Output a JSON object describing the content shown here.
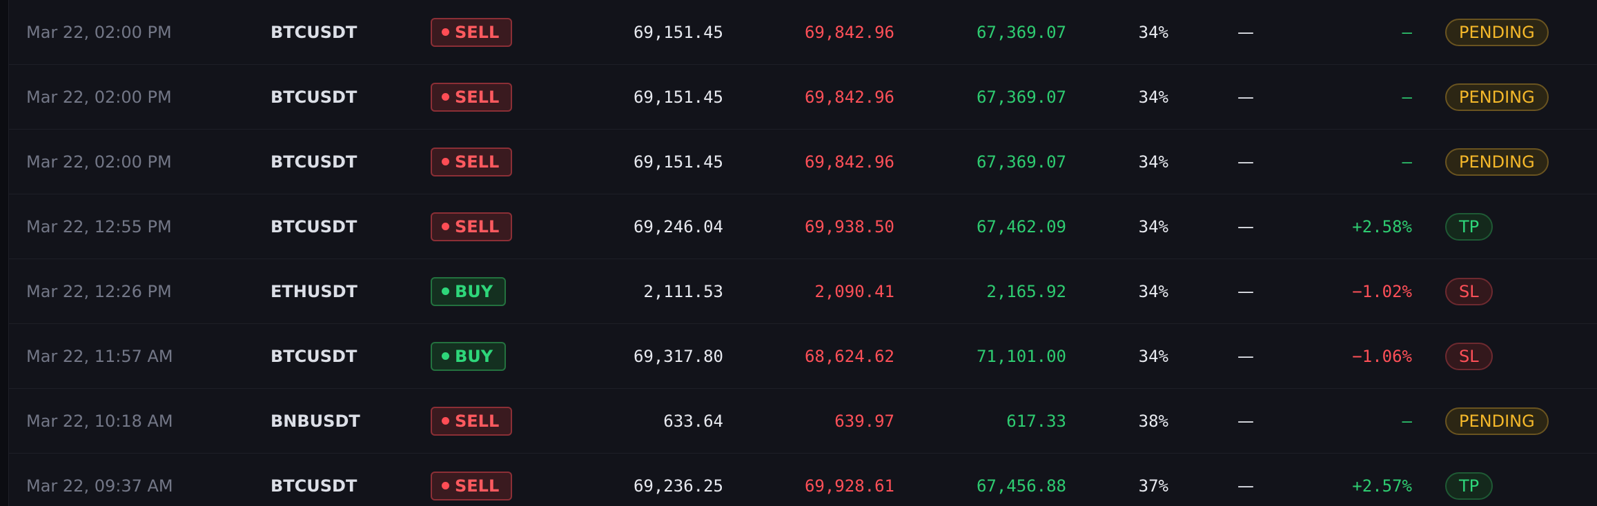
{
  "rows": [
    {
      "time": "Mar 22, 02:00 PM",
      "symbol": "BTCUSDT",
      "side": "SELL",
      "entry": "69,151.45",
      "stop": "69,842.96",
      "target": "67,369.07",
      "confidence": "34%",
      "exit": "—",
      "pnl": "—",
      "status": "PENDING"
    },
    {
      "time": "Mar 22, 02:00 PM",
      "symbol": "BTCUSDT",
      "side": "SELL",
      "entry": "69,151.45",
      "stop": "69,842.96",
      "target": "67,369.07",
      "confidence": "34%",
      "exit": "—",
      "pnl": "—",
      "status": "PENDING"
    },
    {
      "time": "Mar 22, 02:00 PM",
      "symbol": "BTCUSDT",
      "side": "SELL",
      "entry": "69,151.45",
      "stop": "69,842.96",
      "target": "67,369.07",
      "confidence": "34%",
      "exit": "—",
      "pnl": "—",
      "status": "PENDING"
    },
    {
      "time": "Mar 22, 12:55 PM",
      "symbol": "BTCUSDT",
      "side": "SELL",
      "entry": "69,246.04",
      "stop": "69,938.50",
      "target": "67,462.09",
      "confidence": "34%",
      "exit": "—",
      "pnl": "+2.58%",
      "status": "TP"
    },
    {
      "time": "Mar 22, 12:26 PM",
      "symbol": "ETHUSDT",
      "side": "BUY",
      "entry": "2,111.53",
      "stop": "2,090.41",
      "target": "2,165.92",
      "confidence": "34%",
      "exit": "—",
      "pnl": "−1.02%",
      "status": "SL"
    },
    {
      "time": "Mar 22, 11:57 AM",
      "symbol": "BTCUSDT",
      "side": "BUY",
      "entry": "69,317.80",
      "stop": "68,624.62",
      "target": "71,101.00",
      "confidence": "34%",
      "exit": "—",
      "pnl": "−1.06%",
      "status": "SL"
    },
    {
      "time": "Mar 22, 10:18 AM",
      "symbol": "BNBUSDT",
      "side": "SELL",
      "entry": "633.64",
      "stop": "639.97",
      "target": "617.33",
      "confidence": "38%",
      "exit": "—",
      "pnl": "—",
      "status": "PENDING"
    },
    {
      "time": "Mar 22, 09:37 AM",
      "symbol": "BTCUSDT",
      "side": "SELL",
      "entry": "69,236.25",
      "stop": "69,928.61",
      "target": "67,456.88",
      "confidence": "37%",
      "exit": "—",
      "pnl": "+2.57%",
      "status": "TP"
    }
  ],
  "colors": {
    "background": "#12131a",
    "sell": "#ff5a5f",
    "buy": "#2ed67a",
    "pending": "#f5b82a",
    "profit": "#2ecc71",
    "loss": "#ff5058"
  },
  "icons": {
    "side_dot": "dot-icon"
  }
}
